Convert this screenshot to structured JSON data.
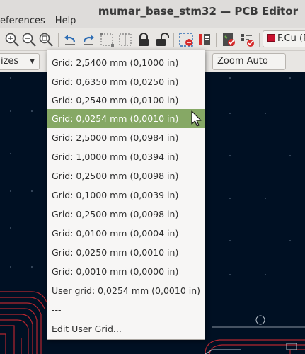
{
  "window": {
    "title": "mumar_base_stm32 — PCB Editor"
  },
  "menu": [
    "eferences",
    "Help"
  ],
  "toolbar": {
    "icons": [
      "zoom-in-icon",
      "zoom-out-icon",
      "zoom-fit-icon",
      "undo-icon",
      "redo-icon",
      "select-icon",
      "align-icon",
      "lock-icon",
      "unlock-icon",
      "drc-icon",
      "netlist-icon",
      "pad-icon",
      "checklist-icon"
    ],
    "layer_label": "F.Cu (Pc",
    "layer_color": "#c8102e"
  },
  "toolbar2": {
    "sizes_label": "izes",
    "zoom_label": "Zoom Auto"
  },
  "grid_dropdown": {
    "items": [
      "Grid: 2,5400 mm (0,1000 in)",
      "Grid: 0,6350 mm (0,0250 in)",
      "Grid: 0,2540 mm (0,0100 in)",
      "Grid: 0,0254 mm (0,0010 in)",
      "Grid: 2,5000 mm (0,0984 in)",
      "Grid: 1,0000 mm (0,0394 in)",
      "Grid: 0,2500 mm (0,0098 in)",
      "Grid: 0,1000 mm (0,0039 in)",
      "Grid: 0,2500 mm (0,0098 in)",
      "Grid: 0,0100 mm (0,0004 in)",
      "Grid: 0,0250 mm (0,0010 in)",
      "Grid: 0,0010 mm (0,0000 in)",
      "User grid: 0,0254 mm (0,0010 in)",
      "---",
      "Edit User Grid..."
    ],
    "selected_index": 3,
    "selected_color": "#86a865"
  },
  "canvas": {
    "background": "#001023",
    "trace_color": "#b3262f"
  }
}
